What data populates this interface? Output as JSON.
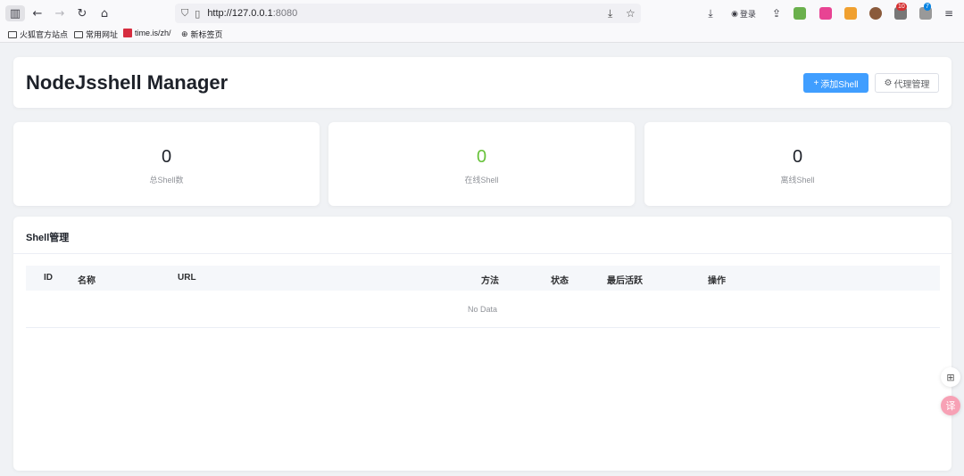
{
  "browser": {
    "url_host": "http://127.0.0.1",
    "url_port": ":8080",
    "login_label": "登录",
    "ext_badge_1": "10",
    "ext_badge_2": "7",
    "bookmarks": [
      {
        "label": "火狐官方站点"
      },
      {
        "label": "常用网址"
      },
      {
        "label": "time.is/zh/"
      },
      {
        "label": "新标签页"
      }
    ]
  },
  "header": {
    "title": "NodeJsshell Manager",
    "add_button": "添加Shell",
    "add_icon": "+",
    "proxy_button": "代理管理",
    "proxy_icon": "⚙"
  },
  "stats": [
    {
      "value": "0",
      "label": "总Shell数",
      "color": "#1d2129"
    },
    {
      "value": "0",
      "label": "在线Shell",
      "color": "#67c23a"
    },
    {
      "value": "0",
      "label": "离线Shell",
      "color": "#1d2129"
    }
  ],
  "manage": {
    "title": "Shell管理",
    "columns": [
      "ID",
      "名称",
      "URL",
      "方法",
      "状态",
      "最后活跃",
      "操作"
    ],
    "empty_text": "No Data"
  },
  "colors": {
    "primary": "#409eff",
    "online": "#67c23a"
  }
}
